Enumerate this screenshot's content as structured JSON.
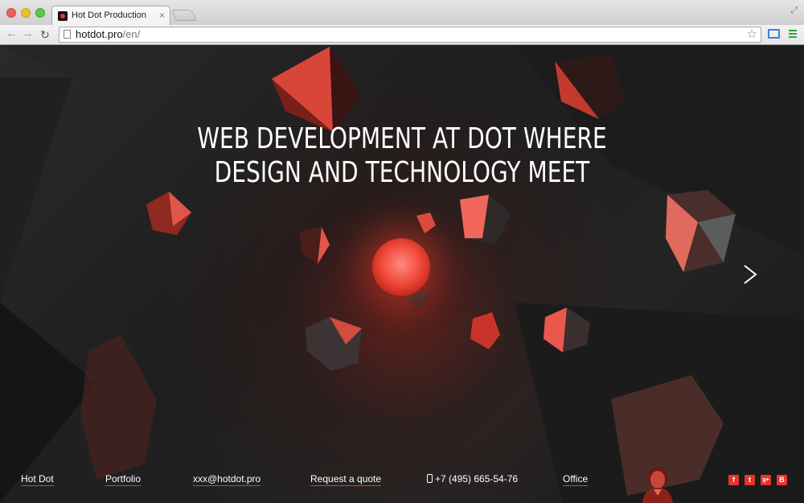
{
  "browser": {
    "tab_title": "Hot Dot Production",
    "tab_close": "×",
    "url_host": "hotdot.pro",
    "url_path": "/en/",
    "icons": [
      "back-icon",
      "forward-icon",
      "reload-icon",
      "page-icon",
      "star-icon",
      "cast-icon",
      "menu-icon",
      "fullscreen-icon"
    ]
  },
  "hero": {
    "headline_line1": "WEB DEVELOPMENT AT DOT WHERE",
    "headline_line2": "DESIGN AND TECHNOLOGY MEET",
    "next_icon": "chevron-right-icon"
  },
  "footer": {
    "links": [
      "Hot Dot",
      "Portfolio",
      "xxx@hotdot.pro",
      "Request a quote",
      "+7 (495) 665-54-76",
      "Office"
    ],
    "social": [
      "f",
      "t",
      "g+",
      "B"
    ]
  },
  "colors": {
    "accent": "#e2372c",
    "background": "#1f1f1f",
    "text": "#ffffff"
  }
}
